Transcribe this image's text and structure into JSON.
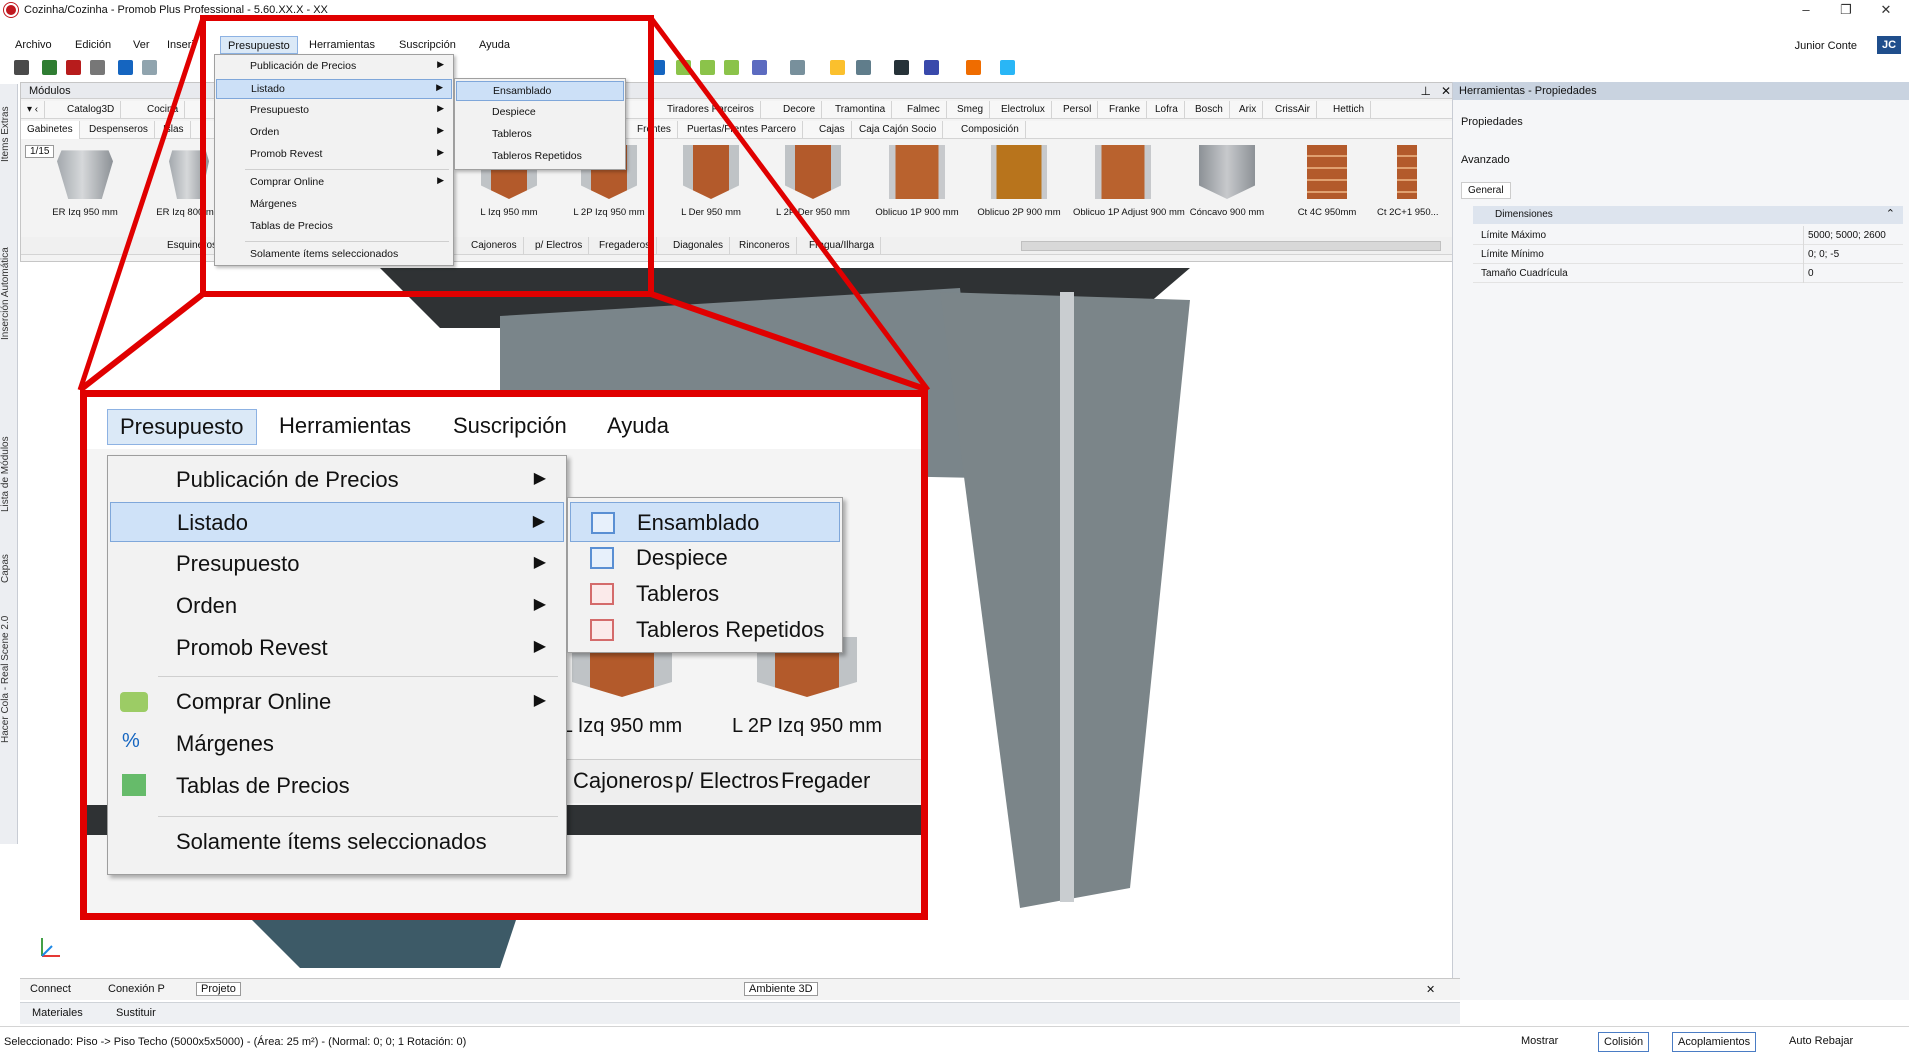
{
  "window": {
    "title": "Cozinha/Cozinha - Promob Plus Professional - 5.60.XX.X - XX",
    "user": "Junior Conte",
    "user_initials": "JC"
  },
  "menubar": [
    "Archivo",
    "Edición",
    "Ver",
    "Inserir",
    "Presupuesto",
    "Herramientas",
    "Suscripción",
    "Ayuda"
  ],
  "presupuesto_menu": {
    "items": [
      {
        "label": "Publicación de Precios",
        "submenu": true
      },
      {
        "label": "Listado",
        "submenu": true,
        "highlighted": true
      },
      {
        "label": "Presupuesto",
        "submenu": true
      },
      {
        "label": "Orden",
        "submenu": true
      },
      {
        "label": "Promob Revest",
        "submenu": true
      },
      {
        "label": "Comprar Online",
        "submenu": true
      },
      {
        "label": "Márgenes",
        "submenu": false
      },
      {
        "label": "Tablas de Precios",
        "submenu": false
      },
      {
        "label": "Solamente ítems seleccionados",
        "submenu": false
      }
    ]
  },
  "listado_submenu": [
    "Ensamblado",
    "Despiece",
    "Tableros",
    "Tableros Repetidos"
  ],
  "modulos": {
    "title": "Módulos",
    "catalog_tabs": [
      "Catalog3D",
      "Cocina",
      "Tiradores Parceiros",
      "Decore",
      "Tramontina",
      "Falmec",
      "Smeg",
      "Electrolux",
      "Persol",
      "Franke",
      "Lofra",
      "Bosch",
      "Arix",
      "CrissAir",
      "Hettich"
    ],
    "category_tabs": [
      "Gabinetes",
      "Despenseros",
      "Islas",
      "Frentes",
      "Puertas/Frentes Parcero",
      "Cajas",
      "Caja Cajón Socio",
      "Composición"
    ],
    "page": "1/15",
    "thumbnails": [
      "ER Izq 950 mm",
      "ER Izq 800 mm",
      "L Izq 950 mm",
      "L 2P Izq 950 mm",
      "L Der 950 mm",
      "L 2P Der 950 mm",
      "Oblicuo 1P 900 mm",
      "Oblicuo 2P 900 mm",
      "Oblicuo 1P Adjust 900 mm",
      "Cóncavo 900 mm",
      "Ct 4C 950mm",
      "Ct 2C+1 950..."
    ],
    "bottom_tabs": [
      "Esquineros",
      "Cajoneros",
      "p/ Electros",
      "Fregaderos",
      "Diagonales",
      "Rinconeros",
      "Fragua/Ilharga"
    ]
  },
  "zoom_labels": {
    "thumb_a": "L Izq 950 mm",
    "thumb_b": "L 2P Izq 950 mm",
    "tabs": [
      "Cajoneros",
      "p/ Electros",
      "Fregader"
    ]
  },
  "properties": {
    "title": "Herramientas - Propiedades",
    "tab": "Propiedades",
    "advanced": "Avanzado",
    "group_tab": "General",
    "section": "Dimensiones",
    "rows": [
      {
        "k": "Límite Máximo",
        "v": "5000; 5000; 2600"
      },
      {
        "k": "Límite Mínimo",
        "v": "0; 0; -5"
      },
      {
        "k": "Tamaño Cuadrícula",
        "v": "0"
      }
    ]
  },
  "left_dock": [
    "Items Extras",
    "Inserción Automática",
    "Lista de Módulos",
    "Capas",
    "Hacer Cola - Real Scene 2.0"
  ],
  "bottom_tabs": {
    "connect": "Connect",
    "conexion": "Conexión P",
    "projeto": "Projeto",
    "ambiente": "Ambiente 3D"
  },
  "mat_bar": {
    "materiales": "Materiales",
    "sustituir": "Sustituir"
  },
  "status": {
    "text": "Seleccionado: Piso -> Piso Techo (5000x5x5000) - (Área: 25 m²) - (Normal: 0; 0; 1 Rotación: 0)",
    "mostrar": "Mostrar",
    "colision": "Colisión",
    "acoplamientos": "Acoplamientos",
    "auto_rebajar": "Auto Rebajar"
  }
}
